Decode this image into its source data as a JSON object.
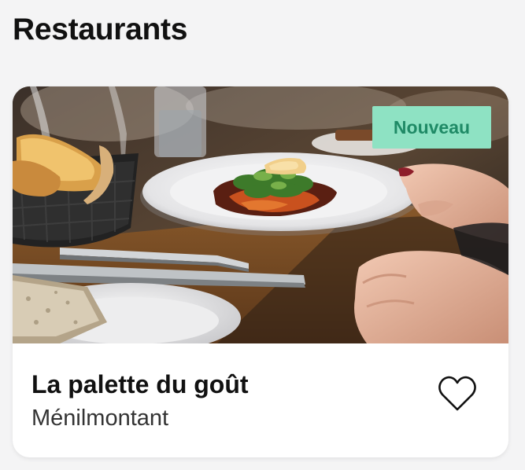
{
  "section": {
    "title": "Restaurants"
  },
  "card": {
    "badge": "Nouveau",
    "name": "La palette du goût",
    "location": "Ménilmontant",
    "favorite_icon": "heart-outline-icon",
    "photo": "restaurant-dish-photo",
    "colors": {
      "badge_bg": "#8ee2c3",
      "badge_text": "#1f8a66"
    }
  }
}
